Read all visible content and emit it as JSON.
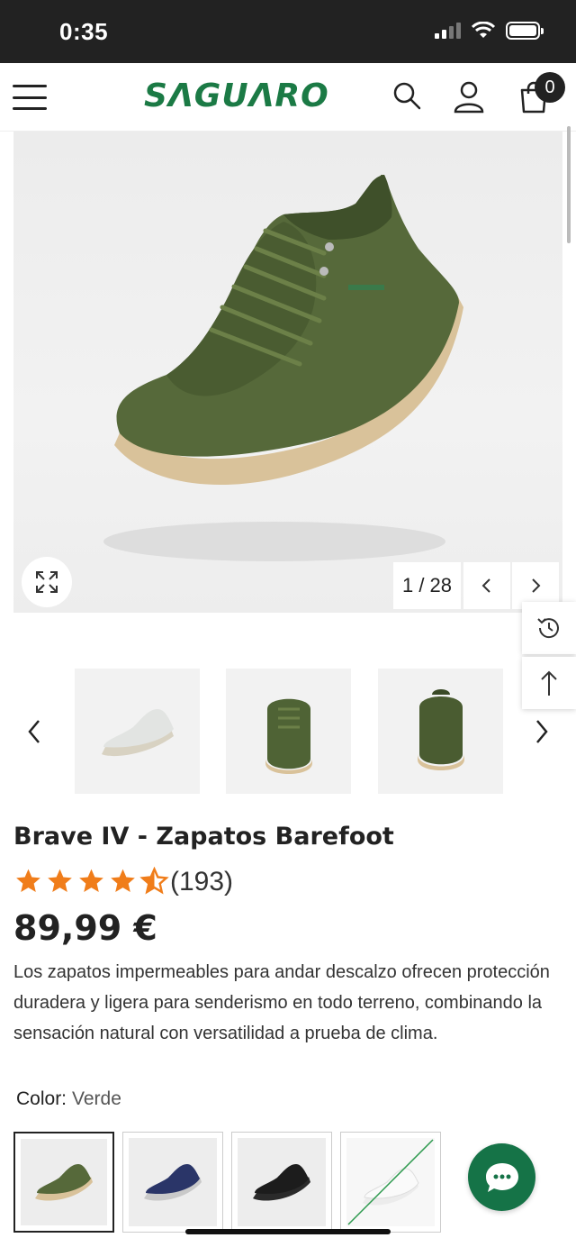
{
  "status": {
    "time": "0:35"
  },
  "header": {
    "logo": "SΛGUΛRO",
    "cart_count": "0"
  },
  "gallery": {
    "counter": "1 / 28"
  },
  "product": {
    "title": "Brave IV - Zapatos Barefoot",
    "rating": 4.5,
    "review_count": "(193)",
    "price": "89,99 €",
    "description": "Los zapatos impermeables para andar descalzo ofrecen protección duradera y ligera para senderismo en todo terreno, combinando la sensación natural con versatilidad a prueba de clima.",
    "color_label": "Color:",
    "color_value": "Verde"
  },
  "colors": {
    "accent": "#1b7a45",
    "star": "#f07d1a",
    "shoe_green": "#56693a",
    "sole": "#d9c29a"
  },
  "swatches": [
    "green",
    "navy",
    "black",
    "white-unavailable"
  ]
}
